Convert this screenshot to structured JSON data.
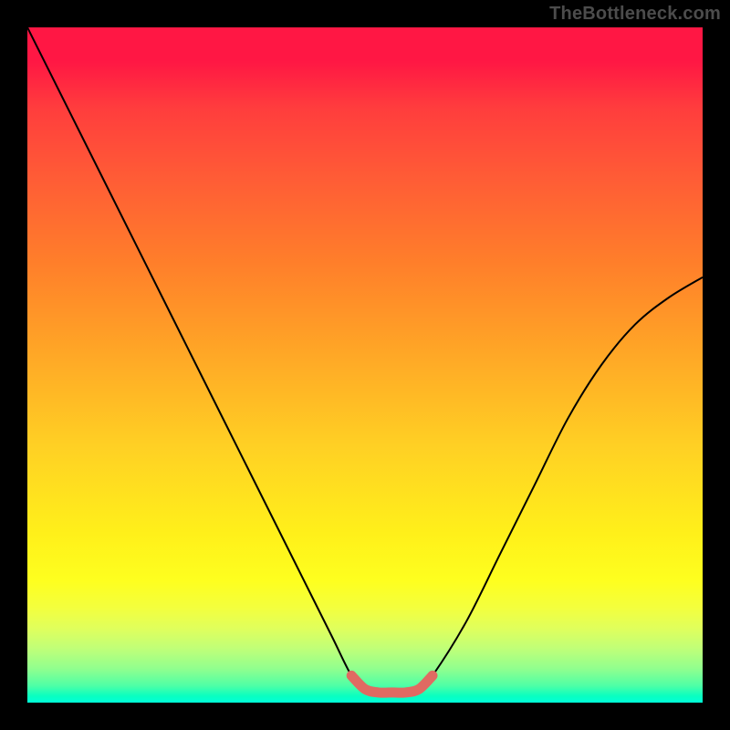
{
  "attribution": "TheBottleneck.com",
  "chart_data": {
    "type": "line",
    "title": "",
    "xlabel": "",
    "ylabel": "",
    "xlim": [
      0,
      100
    ],
    "ylim": [
      0,
      100
    ],
    "series": [
      {
        "name": "curve",
        "x": [
          0,
          5,
          10,
          15,
          20,
          25,
          30,
          35,
          40,
          45,
          48,
          50,
          52,
          54,
          56,
          58,
          60,
          65,
          70,
          75,
          80,
          85,
          90,
          95,
          100
        ],
        "values": [
          100,
          90,
          80,
          70,
          60,
          50,
          40,
          30,
          20,
          10,
          4,
          2,
          1.5,
          1.5,
          1.5,
          2,
          4,
          12,
          22,
          32,
          42,
          50,
          56,
          60,
          63
        ]
      },
      {
        "name": "bottom-highlight",
        "x": [
          48,
          50,
          52,
          54,
          56,
          58,
          60
        ],
        "values": [
          4,
          2,
          1.5,
          1.5,
          1.5,
          2,
          4
        ]
      }
    ],
    "colors": {
      "curve": "#000000",
      "highlight": "#e06a62"
    }
  }
}
